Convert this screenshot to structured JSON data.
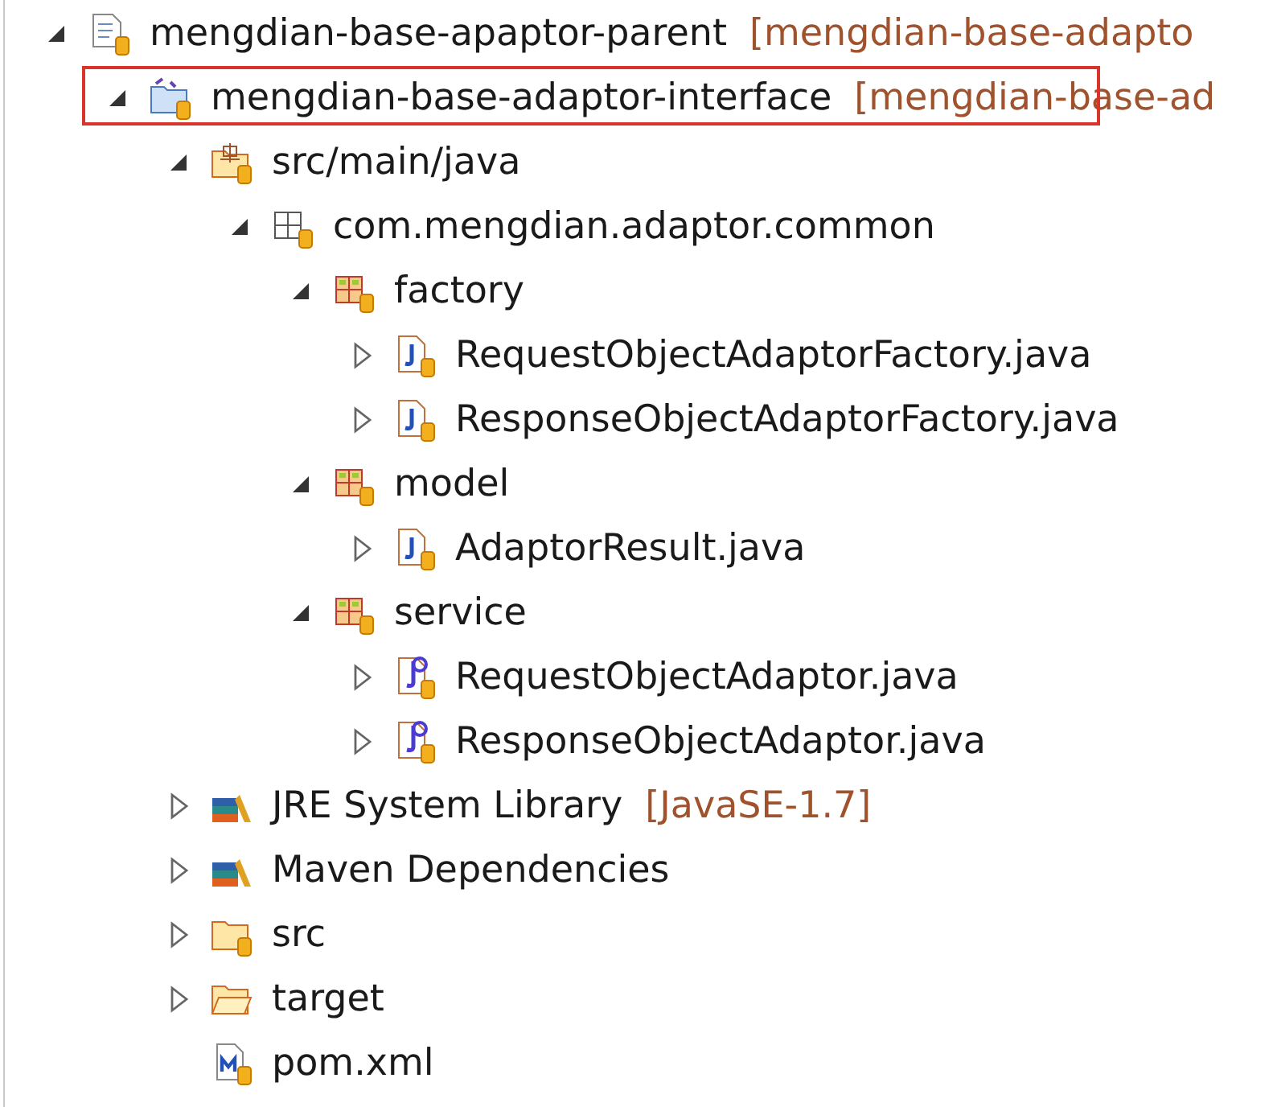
{
  "tree": [
    {
      "kind": "maven-project",
      "label": "mengdian-base-apaptor-parent",
      "decoration": "[mengdian-base-adapto",
      "expanded": true,
      "highlighted": false,
      "children": [
        {
          "kind": "java-project",
          "label": "mengdian-base-adaptor-interface",
          "decoration": "[mengdian-base-ad",
          "expanded": true,
          "highlighted": true,
          "children": [
            {
              "kind": "source-folder",
              "label": "src/main/java",
              "expanded": true,
              "highlighted": false,
              "children": [
                {
                  "kind": "empty-package",
                  "label": "com.mengdian.adaptor.common",
                  "expanded": true,
                  "highlighted": false,
                  "children": [
                    {
                      "kind": "package",
                      "label": "factory",
                      "expanded": true,
                      "highlighted": false,
                      "children": [
                        {
                          "kind": "class",
                          "label": "RequestObjectAdaptorFactory.java",
                          "expanded": false,
                          "highlighted": false
                        },
                        {
                          "kind": "class",
                          "label": "ResponseObjectAdaptorFactory.java",
                          "expanded": false,
                          "highlighted": false
                        }
                      ]
                    },
                    {
                      "kind": "package",
                      "label": "model",
                      "expanded": true,
                      "highlighted": false,
                      "children": [
                        {
                          "kind": "class",
                          "label": "AdaptorResult.java",
                          "expanded": false,
                          "highlighted": false
                        }
                      ]
                    },
                    {
                      "kind": "package",
                      "label": "service",
                      "expanded": true,
                      "highlighted": false,
                      "children": [
                        {
                          "kind": "interface",
                          "label": "RequestObjectAdaptor.java",
                          "expanded": false,
                          "highlighted": false
                        },
                        {
                          "kind": "interface",
                          "label": "ResponseObjectAdaptor.java",
                          "expanded": false,
                          "highlighted": false
                        }
                      ]
                    }
                  ]
                }
              ]
            },
            {
              "kind": "library",
              "label": "JRE System Library",
              "decoration": "[JavaSE-1.7]",
              "expanded": false,
              "highlighted": false
            },
            {
              "kind": "library",
              "label": "Maven Dependencies",
              "expanded": false,
              "highlighted": false
            },
            {
              "kind": "src-folder",
              "label": "src",
              "expanded": false,
              "highlighted": false
            },
            {
              "kind": "folder",
              "label": "target",
              "expanded": false,
              "highlighted": false
            },
            {
              "kind": "pom",
              "label": "pom.xml",
              "highlighted": false
            }
          ]
        }
      ]
    }
  ]
}
